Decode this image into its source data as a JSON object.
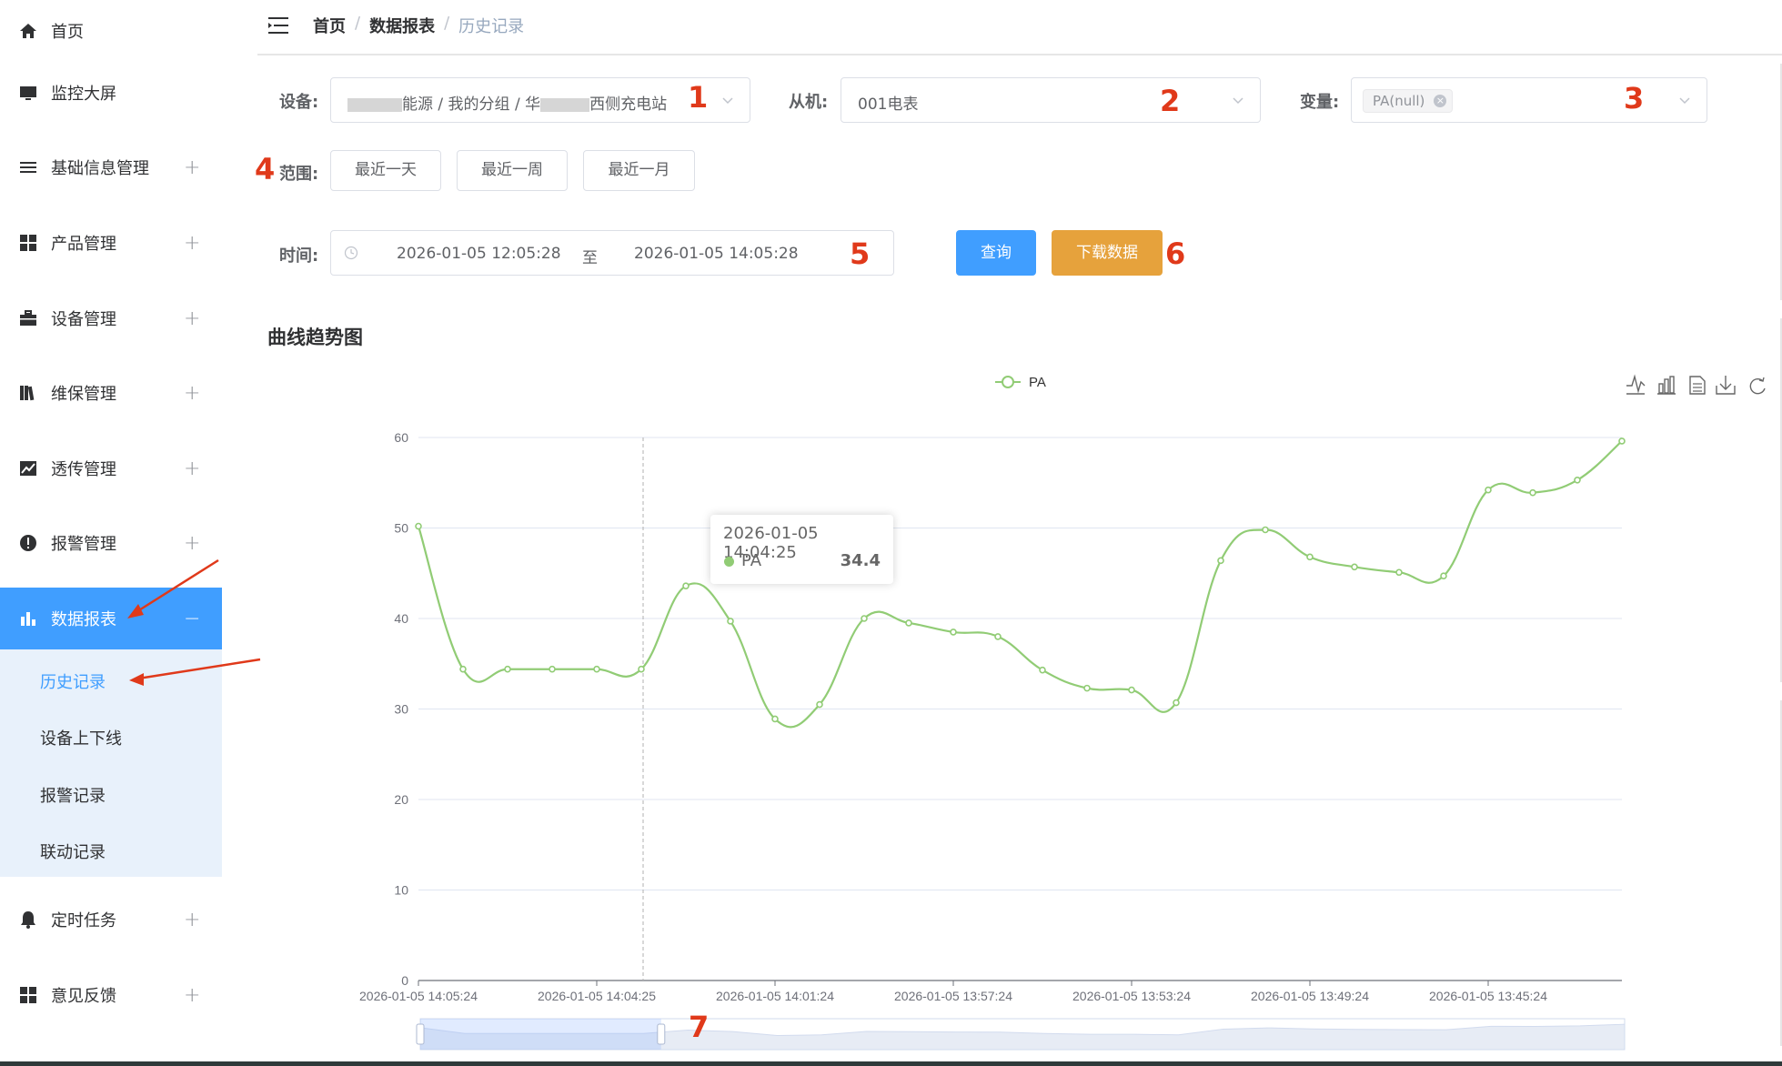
{
  "sidebar": {
    "items": [
      {
        "label": "首页",
        "icon": "home-icon",
        "expandable": false
      },
      {
        "label": "监控大屏",
        "icon": "monitor-icon",
        "expandable": false
      },
      {
        "label": "基础信息管理",
        "icon": "list-icon",
        "expandable": true
      },
      {
        "label": "产品管理",
        "icon": "grid-icon",
        "expandable": true
      },
      {
        "label": "设备管理",
        "icon": "briefcase-icon",
        "expandable": true
      },
      {
        "label": "维保管理",
        "icon": "books-icon",
        "expandable": true
      },
      {
        "label": "透传管理",
        "icon": "trend-icon",
        "expandable": true
      },
      {
        "label": "报警管理",
        "icon": "alert-circle-icon",
        "expandable": true
      },
      {
        "label": "数据报表",
        "icon": "bar-chart-icon",
        "expandable": true,
        "active": true
      },
      {
        "label": "定时任务",
        "icon": "bell-icon",
        "expandable": true
      },
      {
        "label": "意见反馈",
        "icon": "grid-icon",
        "expandable": true
      }
    ],
    "expand_symbol": "+",
    "collapse_symbol": "−",
    "submenu": [
      "历史记录",
      "设备上下线",
      "报警记录",
      "联动记录"
    ],
    "active_submenu": "历史记录"
  },
  "header": {
    "breadcrumb": [
      "首页",
      "数据报表",
      "历史记录"
    ],
    "separator": "/"
  },
  "filters": {
    "device_label": "设备:",
    "device_value_parts": [
      "",
      "能源 / 我的分组 / 华",
      "西侧充电站"
    ],
    "slave_label": "从机:",
    "slave_value": "001电表",
    "variable_label": "变量:",
    "variable_tag": "PA(null)",
    "range_label": "范围:",
    "range_buttons": [
      "最近一天",
      "最近一周",
      "最近一月"
    ],
    "time_label": "时间:",
    "time_start": "2026-01-05 12:05:28",
    "time_sep": "至",
    "time_end": "2026-01-05 14:05:28",
    "query_button": "查询",
    "download_button": "下载数据"
  },
  "annotations": [
    "1",
    "2",
    "3",
    "4",
    "5",
    "6",
    "7"
  ],
  "colors": {
    "primary": "#409eff",
    "warning": "#e6a23c",
    "series": "#91cc75",
    "annotation": "#e0391a"
  },
  "chart_title": "曲线趋势图",
  "chart_data": {
    "type": "line",
    "legend": [
      "PA"
    ],
    "legend_position": "top-center",
    "grid": true,
    "smooth": true,
    "ylim": [
      0,
      60
    ],
    "yticks": [
      0,
      10,
      20,
      30,
      40,
      50,
      60
    ],
    "xtick_labels": [
      "2026-01-05 14:05:24",
      "2026-01-05 14:04:25",
      "2026-01-05 14:01:24",
      "2026-01-05 13:57:24",
      "2026-01-05 13:53:24",
      "2026-01-05 13:49:24",
      "2026-01-05 13:45:24"
    ],
    "series": [
      {
        "name": "PA",
        "values": [
          50.2,
          34.4,
          34.4,
          34.4,
          34.4,
          34.4,
          43.6,
          39.7,
          28.9,
          30.5,
          40.0,
          39.5,
          38.5,
          38.0,
          34.3,
          32.3,
          32.1,
          30.7,
          46.4,
          49.8,
          46.8,
          45.7,
          45.1,
          44.7,
          54.2,
          53.9,
          55.3,
          59.6
        ]
      }
    ],
    "toolbox": [
      "line-chart-icon",
      "bar-chart-icon",
      "data-view-icon",
      "download-icon",
      "refresh-icon"
    ],
    "tooltip": {
      "time": "2026-01-05 14:04:25",
      "series": "PA",
      "value": "34.4"
    },
    "datazoom_range": [
      0,
      20
    ]
  }
}
